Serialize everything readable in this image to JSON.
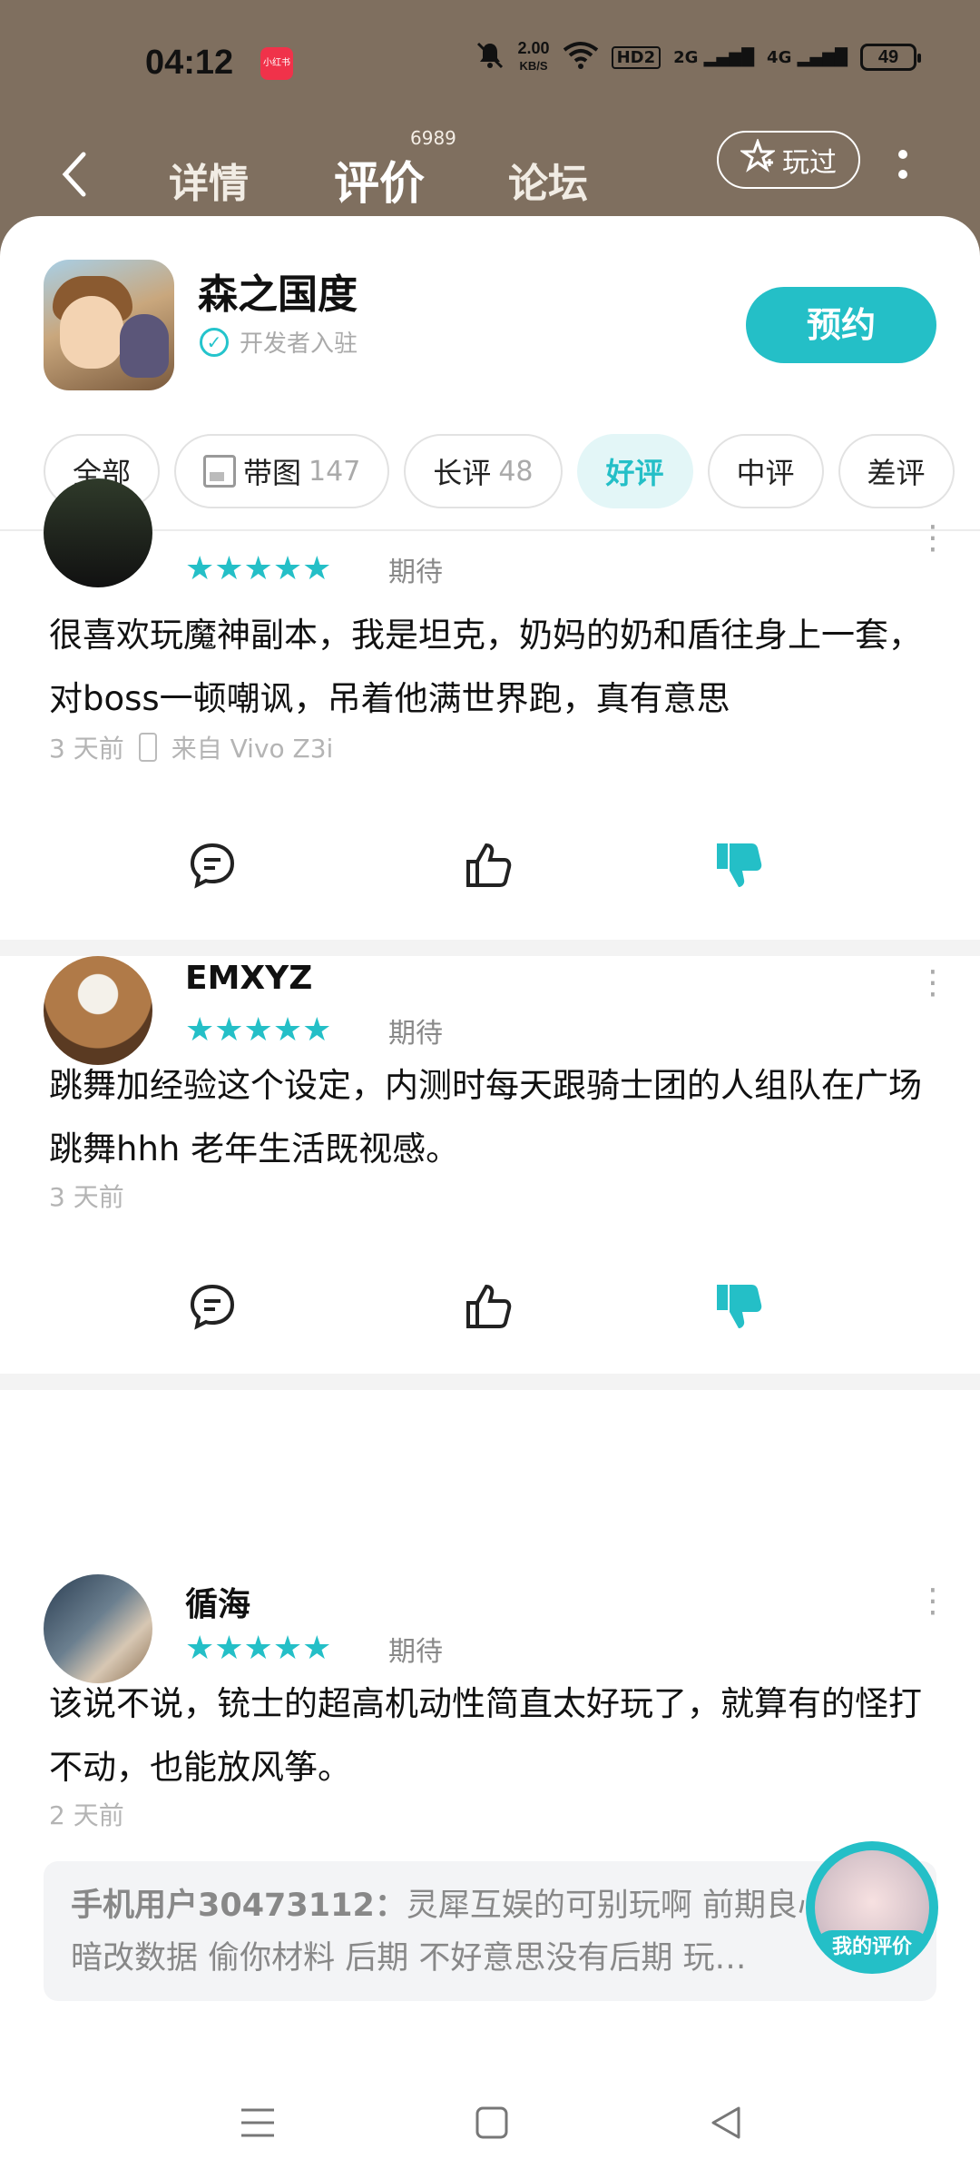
{
  "status_bar": {
    "time": "04:12",
    "app_badge": "小红书",
    "speed_value": "2.00",
    "speed_unit": "KB/S",
    "hd": "HD2",
    "sig1": "2G",
    "sig2": "4G",
    "battery": "49"
  },
  "nav": {
    "tabs": [
      {
        "label": "详情"
      },
      {
        "label": "评价",
        "count": "6989"
      },
      {
        "label": "论坛"
      }
    ],
    "played_label": "玩过"
  },
  "game": {
    "title": "森之国度",
    "developer_label": "开发者入驻",
    "reserve_label": "预约"
  },
  "filters": [
    {
      "label": "全部"
    },
    {
      "label": "带图",
      "count": "147"
    },
    {
      "label": "长评",
      "count": "48"
    },
    {
      "label": "好评"
    },
    {
      "label": "中评"
    },
    {
      "label": "差评"
    }
  ],
  "reviews": [
    {
      "username": "",
      "rating": 5,
      "tag": "期待",
      "text": "很喜欢玩魔神副本，我是坦克，奶妈的奶和盾往身上一套，对boss一顿嘲讽，吊着他满世界跑，真有意思",
      "time": "3 天前",
      "device": "来自 Vivo Z3i"
    },
    {
      "username": "EMXYZ",
      "rating": 5,
      "tag": "期待",
      "text": "跳舞加经验这个设定，内测时每天跟骑士团的人组队在广场跳舞hhh 老年生活既视感。",
      "time": "3 天前"
    },
    {
      "username": "循海",
      "rating": 5,
      "tag": "期待",
      "text": "该说不说，铳士的超高机动性简直太好玩了，就算有的怪打不动，也能放风筝。",
      "time": "2 天前",
      "reply": {
        "user": "手机用户30473112：",
        "text": "灵犀互娱的可别玩啊 前期良心 中期暗改数据 偷你材料 后期 不好意思没有后期 玩…"
      }
    }
  ],
  "fab_label": "我的评价",
  "colors": {
    "accent": "#24bfc7",
    "header_bg": "#7f6f5f"
  }
}
